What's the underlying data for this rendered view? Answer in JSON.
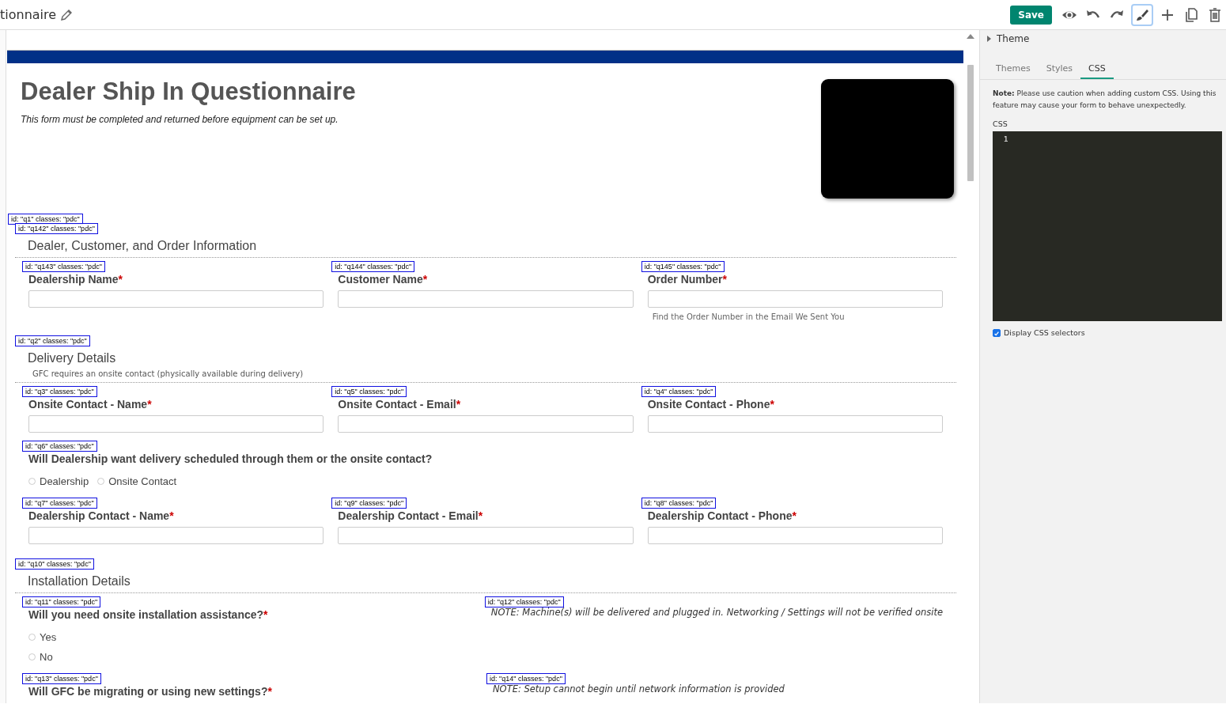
{
  "toolbar": {
    "title": "tionnaire",
    "save": "Save",
    "tools": [
      {
        "kind": "preview",
        "selected": false
      },
      {
        "kind": "undo",
        "selected": false
      },
      {
        "kind": "redo",
        "selected": false
      },
      {
        "kind": "style",
        "selected": true
      },
      {
        "kind": "add",
        "selected": false
      },
      {
        "kind": "copy",
        "selected": false
      },
      {
        "kind": "delete",
        "selected": false
      }
    ]
  },
  "form": {
    "title": "Dealer Ship In Questionnaire",
    "subtitle": "This form must be completed and returned before equipment can be set up.",
    "page_tag": "id: \"q1\" classes: \"pdc\"",
    "sections": [
      {
        "tag": "id: \"q142\" classes: \"pdc\"",
        "heading": "Dealer, Customer, and Order Information",
        "rows": [
          [
            {
              "kind": "text",
              "tag": "id: \"q143\" classes: \"pdc\"",
              "label": "Dealership Name",
              "required_mark": "*"
            },
            {
              "kind": "text",
              "tag": "id: \"q144\" classes: \"pdc\"",
              "label": "Customer Name",
              "required_mark": "*"
            },
            {
              "kind": "text",
              "tag": "id: \"q145\" classes: \"pdc\"",
              "label": "Order Number",
              "required_mark": "*",
              "hint": "Find the Order Number in the Email We Sent You"
            }
          ]
        ]
      },
      {
        "tag": "id: \"q2\" classes: \"pdc\"",
        "heading": "Delivery Details",
        "description": "GFC requires an onsite contact (physically available during delivery)",
        "rows": [
          [
            {
              "kind": "text",
              "tag": "id: \"q3\" classes: \"pdc\"",
              "label": "Onsite Contact - Name",
              "required_mark": "*"
            },
            {
              "kind": "text",
              "tag": "id: \"q5\" classes: \"pdc\"",
              "label": "Onsite Contact - Email",
              "required_mark": "*"
            },
            {
              "kind": "text",
              "tag": "id: \"q4\" classes: \"pdc\"",
              "label": "Onsite Contact - Phone",
              "required_mark": "*"
            }
          ],
          [
            {
              "kind": "radio",
              "tag": "id: \"q6\" classes: \"pdc\"",
              "label": "Will Dealership want delivery scheduled through them or the onsite contact?",
              "inline": true,
              "options": [
                {
                  "label": "Dealership",
                  "selected": false
                },
                {
                  "label": "Onsite Contact",
                  "selected": false
                }
              ]
            }
          ],
          [
            {
              "kind": "text",
              "tag": "id: \"q7\" classes: \"pdc\"",
              "label": "Dealership Contact - Name",
              "required_mark": "*"
            },
            {
              "kind": "text",
              "tag": "id: \"q9\" classes: \"pdc\"",
              "label": "Dealership Contact - Email",
              "required_mark": "*"
            },
            {
              "kind": "text",
              "tag": "id: \"q8\" classes: \"pdc\"",
              "label": "Dealership Contact - Phone",
              "required_mark": "*"
            }
          ]
        ]
      },
      {
        "tag": "id: \"q10\" classes: \"pdc\"",
        "heading": "Installation Details",
        "rows": [
          [
            {
              "kind": "radio",
              "tag": "id: \"q11\" classes: \"pdc\"",
              "label": "Will you need onsite installation assistance?",
              "required_mark": "*",
              "inline": false,
              "options": [
                {
                  "label": "Yes",
                  "selected": false
                },
                {
                  "label": "No",
                  "selected": false
                }
              ]
            },
            {
              "kind": "note",
              "tag": "id: \"q12\" classes: \"pdc\"",
              "text": "NOTE: Machine(s) will be delivered and plugged in. Networking / Settings will not be verified onsite"
            }
          ],
          [
            {
              "kind": "radio",
              "tag": "id: \"q13\" classes: \"pdc\"",
              "label": "Will GFC be migrating or using new settings?",
              "required_mark": "*"
            },
            {
              "kind": "note",
              "tag": "id: \"q14\" classes: \"pdc\"",
              "text": "NOTE: Setup cannot begin until network information is provided"
            }
          ]
        ]
      }
    ]
  },
  "panel": {
    "theme": {
      "label": "Theme",
      "expanded": false
    },
    "tabs": [
      {
        "label": "Themes",
        "selected": false
      },
      {
        "label": "Styles",
        "selected": false
      },
      {
        "label": "CSS",
        "selected": true
      }
    ],
    "note": "**Note:** Please use caution when adding custom CSS. Using this feature may cause your form to behave unexpectedly.",
    "css_label": "CSS",
    "line_numbers": [
      "1"
    ],
    "option": {
      "label": "Display CSS selectors",
      "checked": true
    }
  }
}
